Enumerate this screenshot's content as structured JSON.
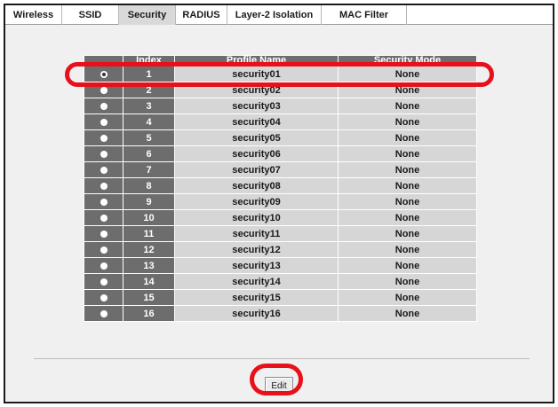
{
  "tabs": [
    {
      "label": "Wireless",
      "active": false
    },
    {
      "label": "SSID",
      "active": false
    },
    {
      "label": "Security",
      "active": true
    },
    {
      "label": "RADIUS",
      "active": false
    },
    {
      "label": "Layer-2 Isolation",
      "active": false
    },
    {
      "label": "MAC Filter",
      "active": false
    }
  ],
  "table": {
    "headers": {
      "select": "",
      "index": "Index",
      "profile_name": "Profile Name",
      "security_mode": "Security Mode"
    },
    "selected_index": "1",
    "rows": [
      {
        "index": "1",
        "profile_name": "security01",
        "security_mode": "None"
      },
      {
        "index": "2",
        "profile_name": "security02",
        "security_mode": "None"
      },
      {
        "index": "3",
        "profile_name": "security03",
        "security_mode": "None"
      },
      {
        "index": "4",
        "profile_name": "security04",
        "security_mode": "None"
      },
      {
        "index": "5",
        "profile_name": "security05",
        "security_mode": "None"
      },
      {
        "index": "6",
        "profile_name": "security06",
        "security_mode": "None"
      },
      {
        "index": "7",
        "profile_name": "security07",
        "security_mode": "None"
      },
      {
        "index": "8",
        "profile_name": "security08",
        "security_mode": "None"
      },
      {
        "index": "9",
        "profile_name": "security09",
        "security_mode": "None"
      },
      {
        "index": "10",
        "profile_name": "security10",
        "security_mode": "None"
      },
      {
        "index": "11",
        "profile_name": "security11",
        "security_mode": "None"
      },
      {
        "index": "12",
        "profile_name": "security12",
        "security_mode": "None"
      },
      {
        "index": "13",
        "profile_name": "security13",
        "security_mode": "None"
      },
      {
        "index": "14",
        "profile_name": "security14",
        "security_mode": "None"
      },
      {
        "index": "15",
        "profile_name": "security15",
        "security_mode": "None"
      },
      {
        "index": "16",
        "profile_name": "security16",
        "security_mode": "None"
      }
    ]
  },
  "edit_label": "Edit",
  "colors": {
    "highlight": "#e8101a",
    "header_bg": "#6d6d6d",
    "cell_bg": "#d6d6d6",
    "active_tab": "#d9d9d9",
    "content_bg": "#f0f0f0"
  }
}
